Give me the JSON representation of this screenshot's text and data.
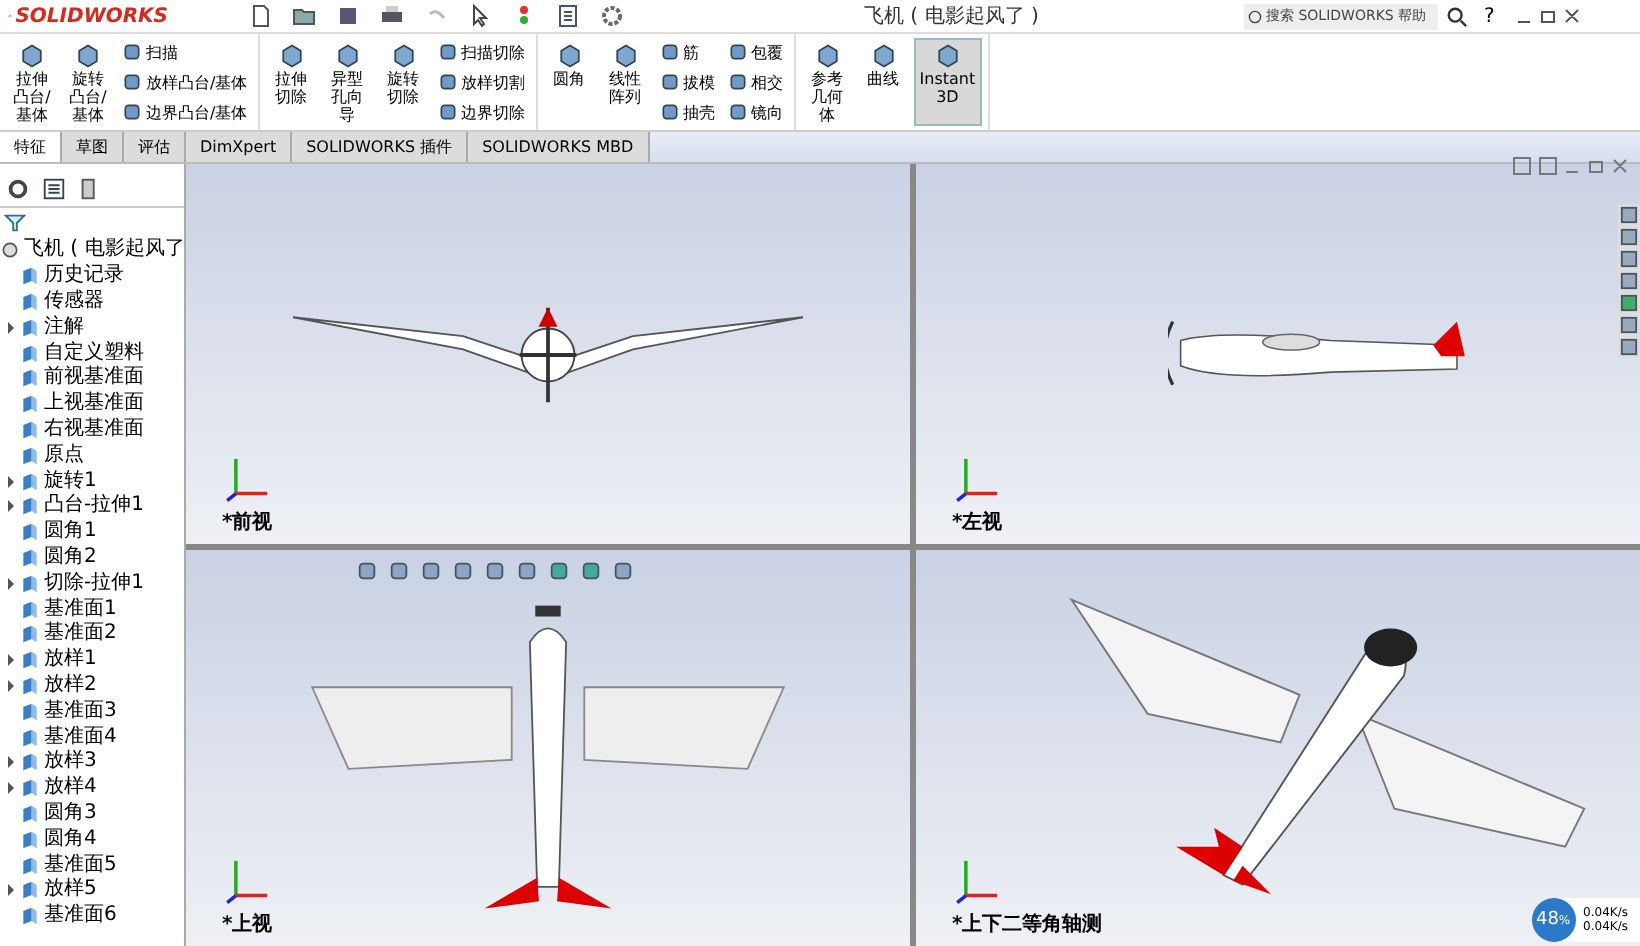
{
  "title_bar": {
    "logo": "SOLIDWORKS",
    "document_title": "飞机 ( 电影起风了 )",
    "search": {
      "placeholder": "搜索 SOLIDWORKS 帮助"
    },
    "help": "?"
  },
  "ribbon": {
    "groups": [
      {
        "items": [
          {
            "kind": "big",
            "label": "拉伸凸台/基体",
            "selected": false
          },
          {
            "kind": "big",
            "label": "旋转凸台/基体",
            "selected": false
          },
          {
            "kind": "stack",
            "items": [
              "扫描",
              "放样凸台/基体",
              "边界凸台/基体"
            ]
          }
        ]
      },
      {
        "items": [
          {
            "kind": "big",
            "label": "拉伸切除",
            "selected": false
          },
          {
            "kind": "big",
            "label": "异型孔向导",
            "selected": false
          },
          {
            "kind": "big",
            "label": "旋转切除",
            "selected": false
          },
          {
            "kind": "stack",
            "items": [
              "扫描切除",
              "放样切割",
              "边界切除"
            ]
          }
        ]
      },
      {
        "items": [
          {
            "kind": "big",
            "label": "圆角",
            "selected": false
          },
          {
            "kind": "big",
            "label": "线性阵列",
            "selected": false
          },
          {
            "kind": "stack",
            "items": [
              "筋",
              "拔模",
              "抽壳"
            ]
          },
          {
            "kind": "stack",
            "items": [
              "包覆",
              "相交",
              "镜向"
            ]
          }
        ]
      },
      {
        "items": [
          {
            "kind": "big",
            "label": "参考几何体",
            "selected": false
          },
          {
            "kind": "big",
            "label": "曲线",
            "selected": false
          },
          {
            "kind": "big",
            "label": "Instant3D",
            "selected": true
          }
        ]
      }
    ]
  },
  "tabs": [
    {
      "label": "特征",
      "selected": true
    },
    {
      "label": "草图",
      "selected": false
    },
    {
      "label": "评估",
      "selected": false
    },
    {
      "label": "DimXpert",
      "selected": false
    },
    {
      "label": "SOLIDWORKS 插件",
      "selected": false
    },
    {
      "label": "SOLIDWORKS MBD",
      "selected": false
    }
  ],
  "feature_tree": {
    "root": "飞机 ( 电影起风了",
    "children": [
      {
        "label": "历史记录",
        "collapsed": false
      },
      {
        "label": "传感器",
        "collapsed": false
      },
      {
        "label": "注解",
        "collapsed": true
      },
      {
        "label": "自定义塑料",
        "collapsed": false
      },
      {
        "label": "前视基准面",
        "collapsed": false
      },
      {
        "label": "上视基准面",
        "collapsed": false
      },
      {
        "label": "右视基准面",
        "collapsed": false
      },
      {
        "label": "原点",
        "collapsed": false
      },
      {
        "label": "旋转1",
        "collapsed": true
      },
      {
        "label": "凸台-拉伸1",
        "collapsed": true
      },
      {
        "label": "圆角1",
        "collapsed": false
      },
      {
        "label": "圆角2",
        "collapsed": false
      },
      {
        "label": "切除-拉伸1",
        "collapsed": true
      },
      {
        "label": "基准面1",
        "collapsed": false
      },
      {
        "label": "基准面2",
        "collapsed": false
      },
      {
        "label": "放样1",
        "collapsed": true
      },
      {
        "label": "放样2",
        "collapsed": true
      },
      {
        "label": "基准面3",
        "collapsed": false
      },
      {
        "label": "基准面4",
        "collapsed": false
      },
      {
        "label": "放样3",
        "collapsed": true
      },
      {
        "label": "放样4",
        "collapsed": true
      },
      {
        "label": "圆角3",
        "collapsed": false
      },
      {
        "label": "圆角4",
        "collapsed": false
      },
      {
        "label": "基准面5",
        "collapsed": false
      },
      {
        "label": "放样5",
        "collapsed": true
      },
      {
        "label": "基准面6",
        "collapsed": false
      }
    ]
  },
  "viewports": [
    {
      "kind": "front",
      "label": "*前视"
    },
    {
      "kind": "left",
      "label": "*左视"
    },
    {
      "kind": "top",
      "label": "*上视"
    },
    {
      "kind": "iso",
      "label": "*上下二等角轴测"
    }
  ],
  "network_widget": {
    "percent": "48",
    "unit": "%",
    "upload": "0.04K/s",
    "download": "0.04K/s"
  }
}
